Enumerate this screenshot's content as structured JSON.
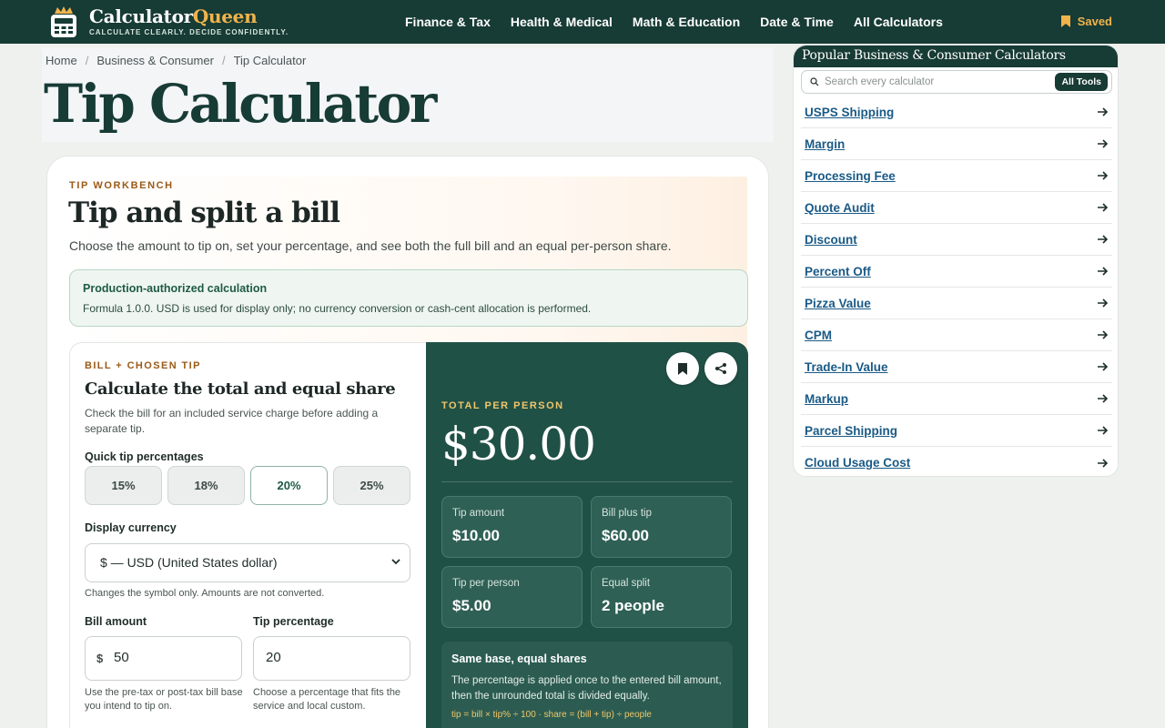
{
  "header": {
    "brand_main": "Calculator",
    "brand_accent": "Queen",
    "tagline": "CALCULATE CLEARLY. DECIDE CONFIDENTLY.",
    "nav": [
      "Finance & Tax",
      "Health & Medical",
      "Math & Education",
      "Date & Time",
      "All Calculators"
    ],
    "saved_label": "Saved",
    "saved_icon": "bookmark-icon"
  },
  "breadcrumb": [
    "Home",
    "Business & Consumer",
    "Tip Calculator"
  ],
  "page_title": "Tip Calculator",
  "workbench": {
    "eyebrow": "TIP WORKBENCH",
    "title": "Tip and split a bill",
    "subtitle": "Choose the amount to tip on, set your percentage, and see both the full bill and an equal per-person share.",
    "notice_title": "Production-authorized calculation",
    "notice_text": "Formula 1.0.0. USD is used for display only; no currency conversion or cash-cent allocation is performed."
  },
  "form": {
    "eyebrow": "BILL + CHOSEN TIP",
    "title": "Calculate the total and equal share",
    "description": "Check the bill for an included service charge before adding a separate tip.",
    "quick_label": "Quick tip percentages",
    "quick_options": [
      "15%",
      "18%",
      "20%",
      "25%"
    ],
    "quick_selected": "20%",
    "currency_label": "Display currency",
    "currency_value": "$ — USD (United States dollar)",
    "currency_hint": "Changes the symbol only. Amounts are not converted.",
    "bill_label": "Bill amount",
    "bill_prefix": "$",
    "bill_value": "50",
    "bill_hint": "Use the pre-tax or post-tax bill base you intend to tip on.",
    "tip_label": "Tip percentage",
    "tip_value": "20",
    "tip_hint": "Choose a percentage that fits the service and local custom."
  },
  "result": {
    "eyebrow": "TOTAL PER PERSON",
    "total_per_person": "$30.00",
    "stats": [
      {
        "label": "Tip amount",
        "value": "$10.00"
      },
      {
        "label": "Bill plus tip",
        "value": "$60.00"
      },
      {
        "label": "Tip per person",
        "value": "$5.00"
      },
      {
        "label": "Equal split",
        "value": "2 people"
      }
    ],
    "info_title": "Same base, equal shares",
    "info_text": "The percentage is applied once to the entered bill amount, then the unrounded total is divided equally.",
    "formula": "tip = bill × tip% ÷ 100 · share = (bill + tip) ÷ people",
    "save_icon": "bookmark-icon",
    "share_icon": "share-icon"
  },
  "sidebar": {
    "title": "Popular Business & Consumer Calculators",
    "search_placeholder": "Search every calculator",
    "all_tools_label": "All Tools",
    "items": [
      "USPS Shipping",
      "Margin",
      "Processing Fee",
      "Quote Audit",
      "Discount",
      "Percent Off",
      "Pizza Value",
      "CPM",
      "Trade-In Value",
      "Markup",
      "Parcel Shipping",
      "Cloud Usage Cost"
    ]
  },
  "colors": {
    "brand_dark": "#173b35",
    "accent_gold": "#f0b44c",
    "result_bg": "#205146",
    "link_blue": "#1a5a86"
  }
}
